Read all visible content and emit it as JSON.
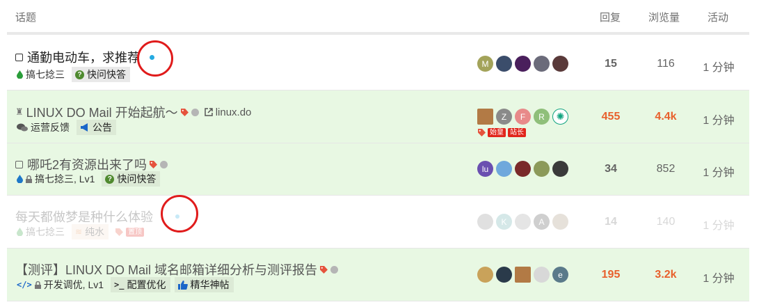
{
  "header": {
    "topic": "话题",
    "replies": "回复",
    "views": "浏览量",
    "activity": "活动"
  },
  "colors": {
    "hot": "#e8602c",
    "green_row": "#e8f8e3",
    "new_dot": "#25aae1",
    "annotation": "#e01b1b"
  },
  "topics": [
    {
      "title": "通勤电动车，求推荐",
      "status_icon": "checkbox-icon",
      "unread_dot": true,
      "meta": {
        "category": "搞七捻三",
        "category_icon": "drop-icon",
        "tag": "快问快答",
        "tag_icon": "question-icon"
      },
      "avatars": [
        "M",
        "",
        "",
        "",
        ""
      ],
      "replies": "15",
      "views": "116",
      "activity": "1 分钟"
    },
    {
      "title": "LINUX DO Mail 开始起航～",
      "status_icon": "pin-icon",
      "link": "linux.do",
      "meta": {
        "category": "运营反馈",
        "category_icon": "chat-icon",
        "tag": "公告",
        "tag_icon": "megaphone-icon"
      },
      "avatars": [
        "",
        "Z",
        "F",
        "R",
        ""
      ],
      "flairs": [
        "始皇",
        "站长"
      ],
      "replies": "455",
      "views": "4.4k",
      "activity": "1 分钟"
    },
    {
      "title": "哪吒2有资源出来了吗",
      "status_icon": "checkbox-icon",
      "meta": {
        "category": "搞七捻三, Lv1",
        "category_icon": "drop-icon",
        "tag": "快问快答",
        "tag_icon": "question-icon"
      },
      "avatars": [
        "lu",
        "",
        "",
        "",
        ""
      ],
      "replies": "34",
      "views": "852",
      "activity": "1 分钟"
    },
    {
      "title": "每天都做梦是种什么体验",
      "meta": {
        "category": "搞七捻三",
        "category_icon": "drop-icon",
        "tag": "纯水",
        "tag_icon": "water-icon",
        "badge": "置顶"
      },
      "avatars": [
        "",
        "K",
        "",
        "A",
        ""
      ],
      "replies": "14",
      "views": "140",
      "activity": "1 分钟"
    },
    {
      "title": "【测评】LINUX DO Mail 域名邮箱详细分析与测评报告",
      "meta": {
        "category": "开发调优, Lv1",
        "category_icon": "code-icon",
        "tag": "配置优化",
        "tag_icon": "terminal-icon",
        "tag2": "精华神帖",
        "tag2_icon": "thumbs-up-icon"
      },
      "avatars": [
        "",
        "",
        "",
        "",
        "e"
      ],
      "replies": "195",
      "views": "3.2k",
      "activity": "1 分钟"
    }
  ]
}
